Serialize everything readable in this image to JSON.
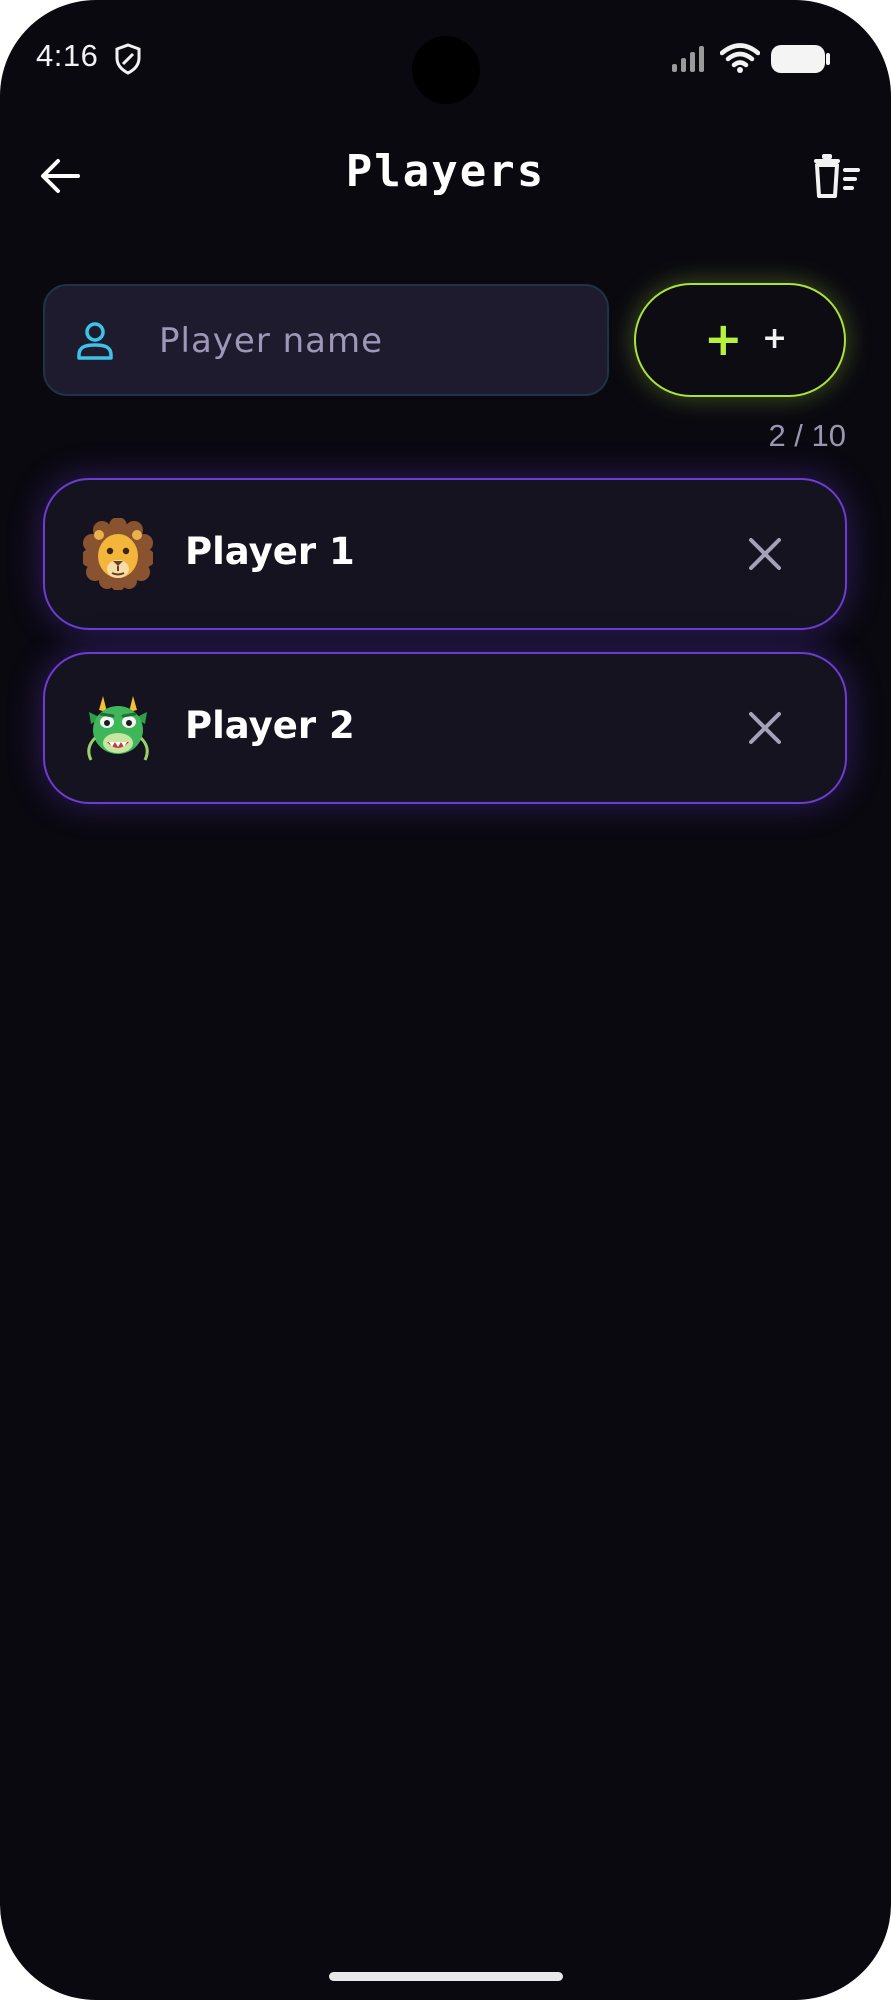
{
  "status_bar": {
    "time": "4:16",
    "icons": [
      "shield-icon",
      "signal-icon",
      "wifi-icon",
      "battery-icon"
    ]
  },
  "header": {
    "title": "Players",
    "back_icon": "arrow-left-icon",
    "clear_icon": "trash-list-icon"
  },
  "input": {
    "placeholder": "Player name",
    "value": "",
    "icon": "person-icon"
  },
  "add_button": {
    "primary_symbol": "+",
    "secondary_symbol": "+"
  },
  "counter": "2 / 10",
  "players": [
    {
      "name": "Player 1",
      "avatar": "lion-emoji"
    },
    {
      "name": "Player 2",
      "avatar": "dragon-face-emoji"
    }
  ],
  "colors": {
    "background": "#0a0910",
    "accent_green": "#a8e23a",
    "accent_purple": "#6a3ed2",
    "input_icon": "#3ec3e8"
  }
}
